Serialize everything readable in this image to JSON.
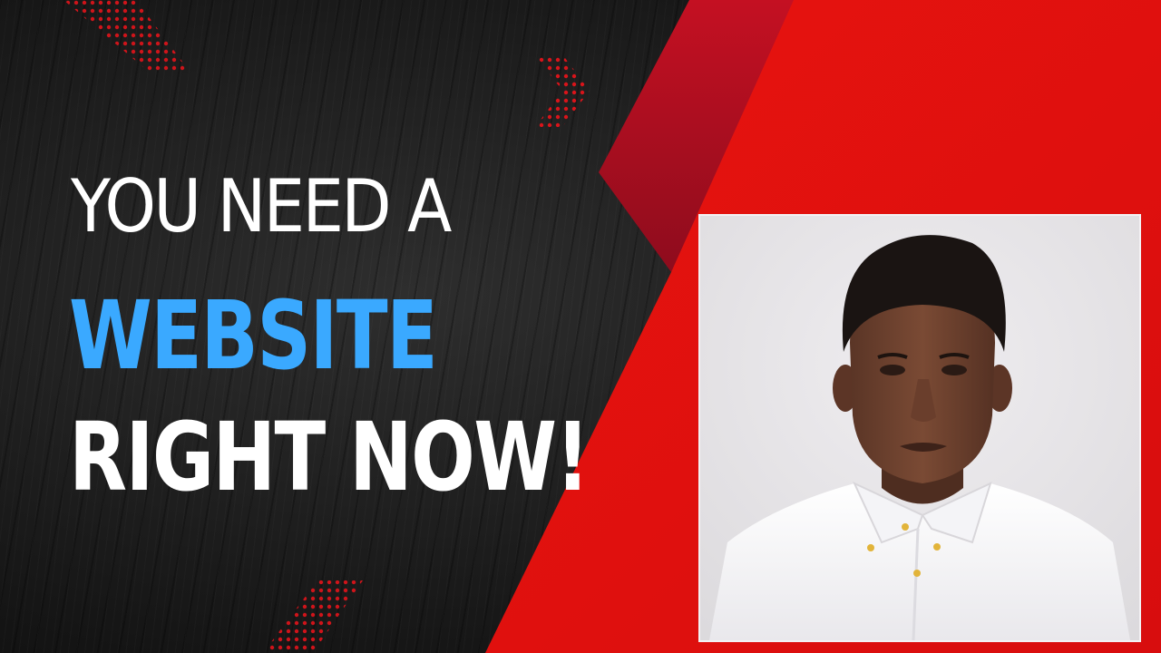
{
  "headline": {
    "line1": "YOU NEED A",
    "line2": "WEBSITE",
    "line3": "RIGHT NOW!"
  },
  "colors": {
    "background": "#1b1b1b",
    "accent_red": "#e20f10",
    "accent_dark_red": "#b10f22",
    "highlight_blue": "#3aa9ff",
    "text_white": "#ffffff"
  },
  "photo": {
    "description": "portrait-photo"
  }
}
